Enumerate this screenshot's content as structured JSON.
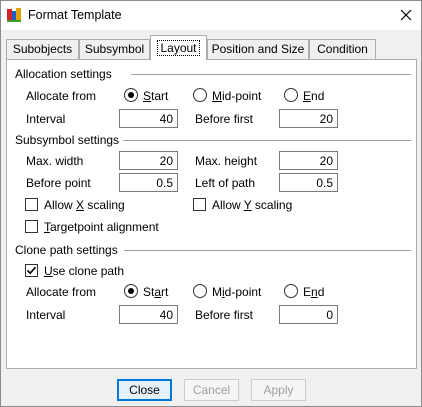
{
  "window": {
    "title": "Format Template"
  },
  "tabs": [
    {
      "label": "Subobjects"
    },
    {
      "label": "Subsymbol"
    },
    {
      "label": "Layout"
    },
    {
      "label": "Position and Size"
    },
    {
      "label": "Condition"
    }
  ],
  "allocation": {
    "title": "Allocation settings",
    "allocate_from_label": "Allocate from",
    "option_start": "Start",
    "option_midpoint": "Mid-point",
    "option_end": "End",
    "selected": "Start",
    "interval_label": "Interval",
    "interval_value": "40",
    "before_first_label": "Before first",
    "before_first_value": "20"
  },
  "subsymbol": {
    "title": "Subsymbol settings",
    "max_width_label": "Max. width",
    "max_width_value": "20",
    "max_height_label": "Max. height",
    "max_height_value": "20",
    "before_point_label": "Before point",
    "before_point_value": "0.5",
    "left_of_path_label": "Left of path",
    "left_of_path_value": "0.5",
    "allow_x_scaling_label": "Allow X scaling",
    "allow_x_scaling_checked": false,
    "allow_y_scaling_label": "Allow Y scaling",
    "allow_y_scaling_checked": false,
    "targetpoint_alignment_label": "Targetpoint alignment",
    "targetpoint_alignment_checked": false
  },
  "clone": {
    "title": "Clone path settings",
    "use_clone_path_label": "Use clone path",
    "use_clone_path_checked": true,
    "allocate_from_label": "Allocate from",
    "option_start": "Start",
    "option_midpoint": "Mid-point",
    "option_end": "End",
    "selected": "Start",
    "interval_label": "Interval",
    "interval_value": "40",
    "before_first_label": "Before first",
    "before_first_value": "0"
  },
  "footer": {
    "close_label": "Close",
    "cancel_label": "Cancel",
    "apply_label": "Apply"
  },
  "colors": {
    "accent": "#0078d7",
    "window_bg": "#f0f0f0",
    "panel_bg": "#ffffff"
  },
  "icons": {
    "app": "format-template-app-icon",
    "close": "close-icon"
  }
}
